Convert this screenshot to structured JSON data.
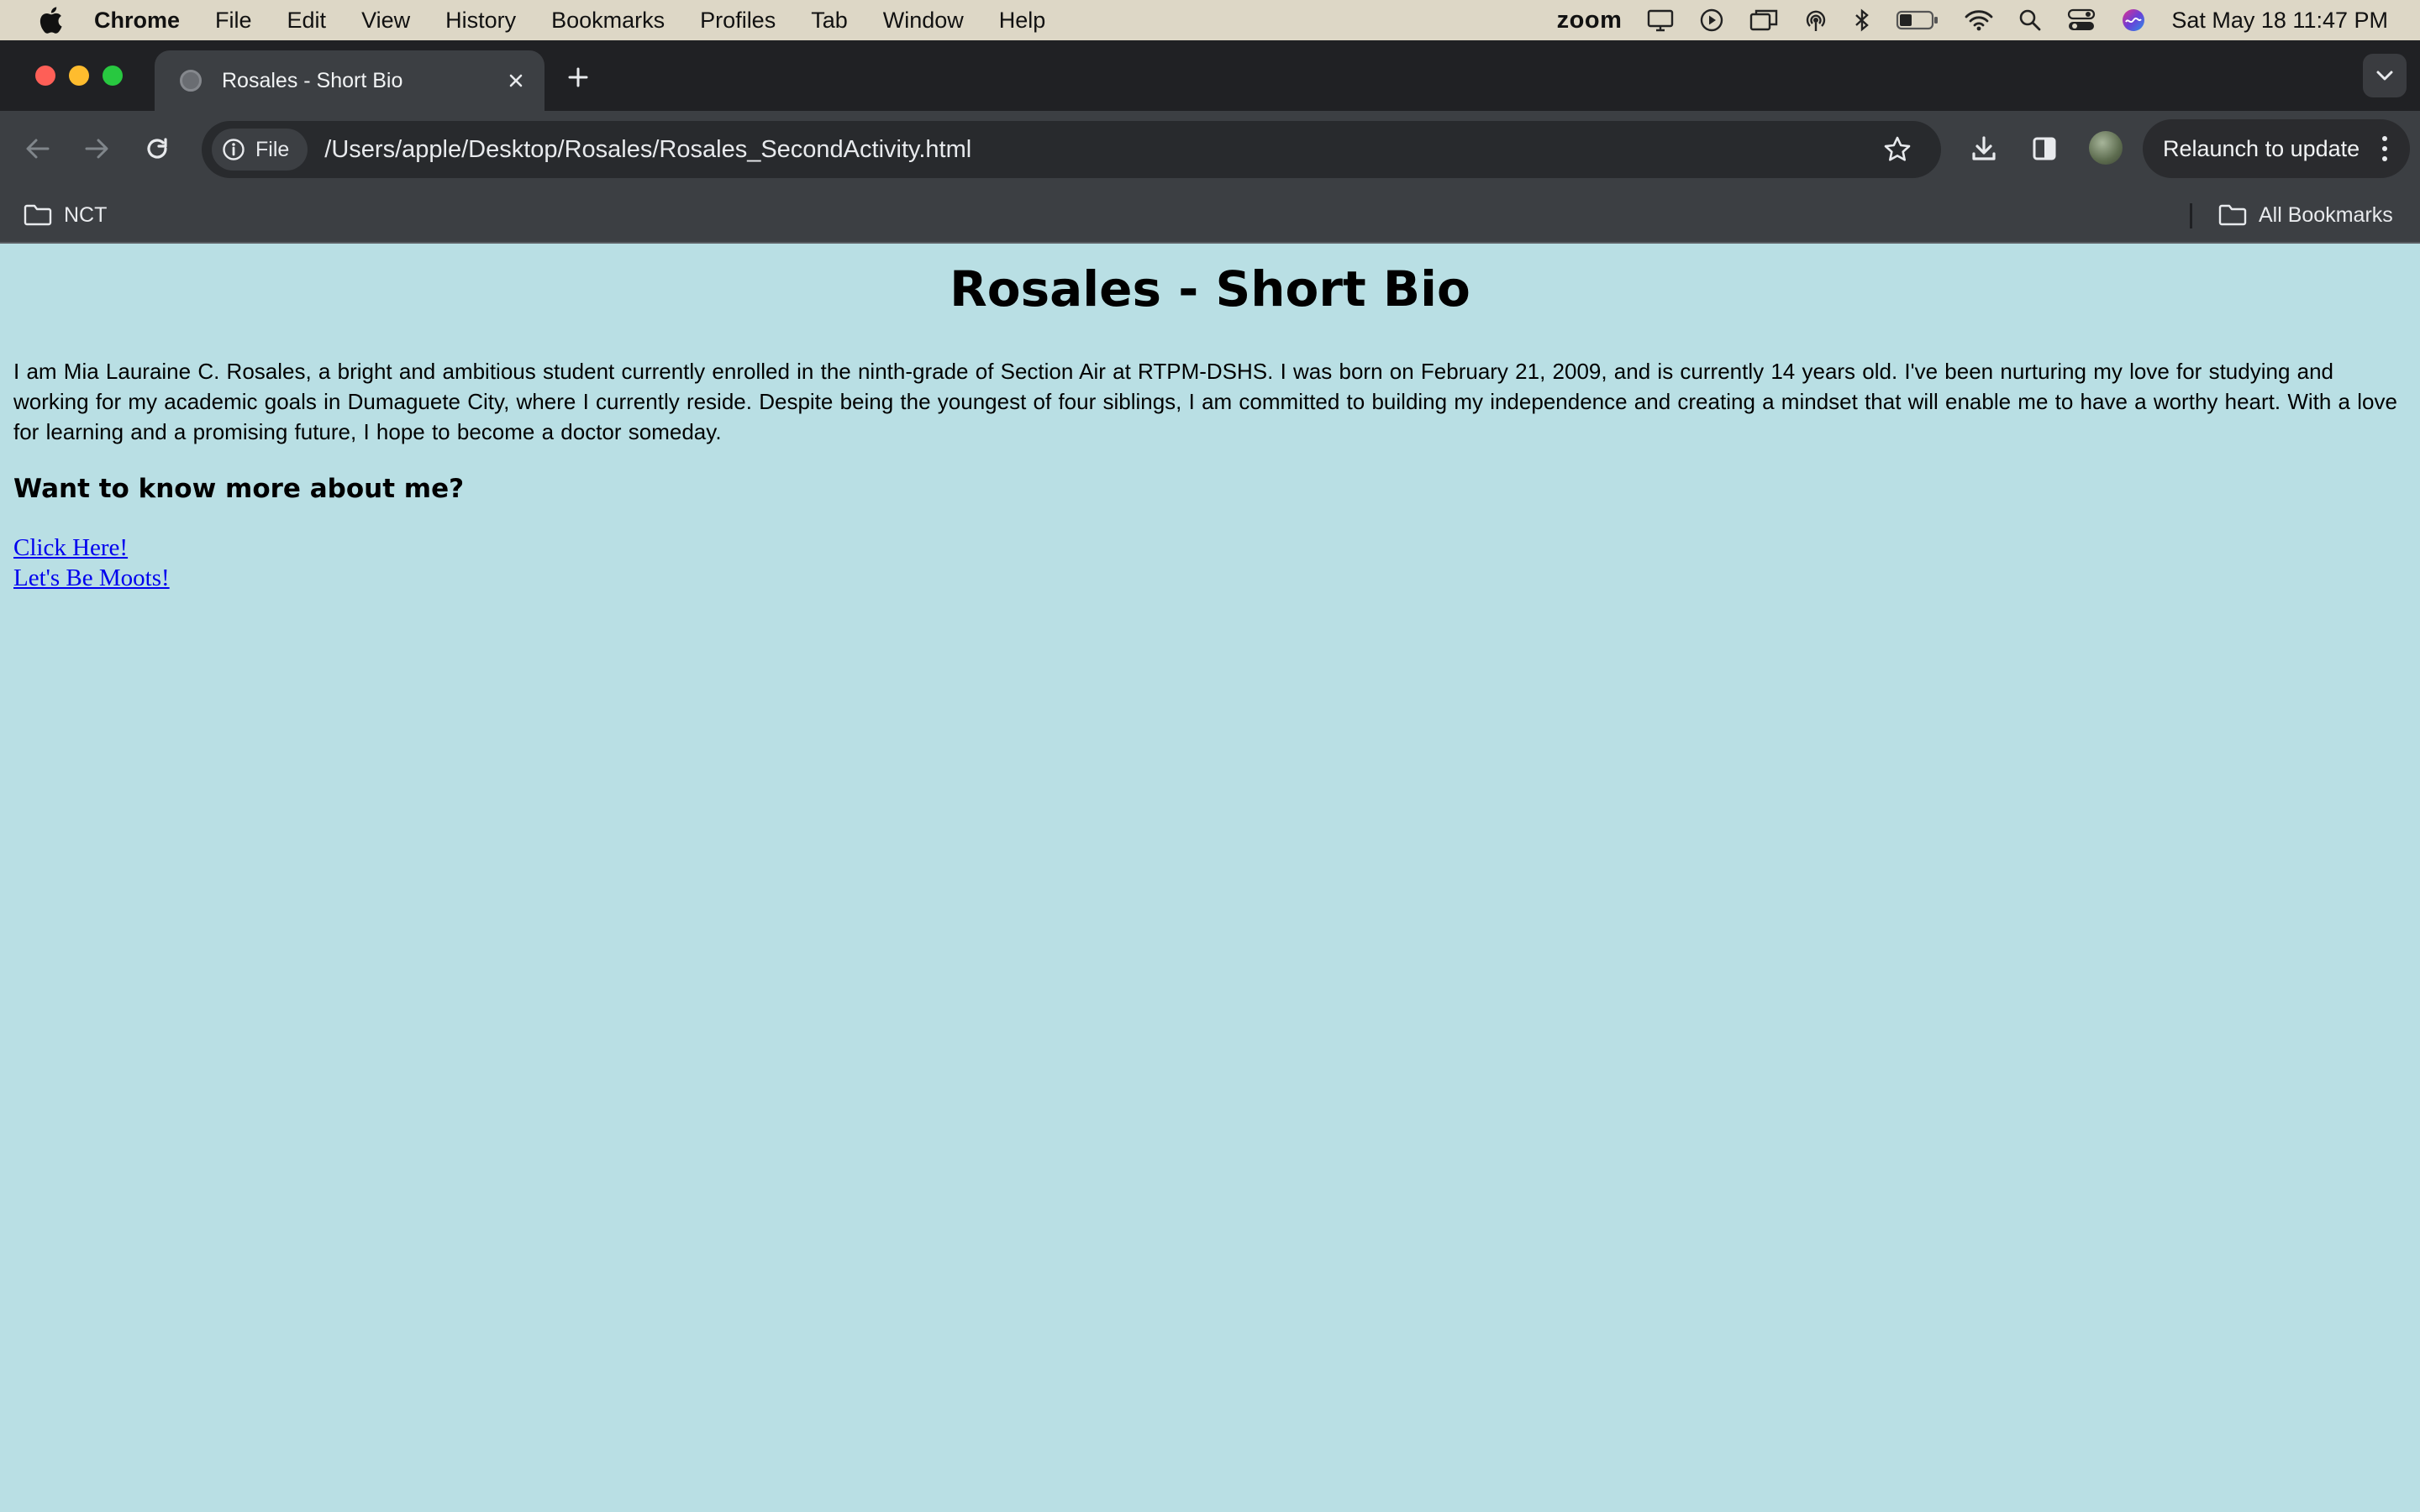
{
  "menubar": {
    "app_name": "Chrome",
    "items": [
      "File",
      "Edit",
      "View",
      "History",
      "Bookmarks",
      "Profiles",
      "Tab",
      "Window",
      "Help"
    ],
    "status_app": "zoom",
    "clock": "Sat May 18  11:47 PM"
  },
  "tab": {
    "title": "Rosales - Short Bio"
  },
  "omnibox": {
    "chip_label": "File",
    "url": "/Users/apple/Desktop/Rosales/Rosales_SecondActivity.html"
  },
  "toolbar": {
    "relaunch_label": "Relaunch to update"
  },
  "bookmarks": {
    "left_folder": "NCT",
    "right_folder": "All Bookmarks"
  },
  "page": {
    "heading": "Rosales - Short Bio",
    "bio": "I am Mia Lauraine C. Rosales, a bright and ambitious student currently enrolled in the ninth-grade of Section Air at RTPM-DSHS. I was born on February 21, 2009, and is currently 14 years old. I've been nurturing my love for studying and working for my academic goals in Dumaguete City, where I currently reside. Despite being the youngest of four siblings, I am committed to building my independence and creating a mindset that will enable me to have a worthy heart. With a love for learning and a promising future, I hope to become a doctor someday.",
    "subheading": "Want to know more about me?",
    "link1": "Click Here!",
    "link2": "Let's Be Moots!"
  },
  "colors": {
    "page_background": "#b9dfe4",
    "link": "#0000ee",
    "chrome_dark": "#3c3f43"
  }
}
